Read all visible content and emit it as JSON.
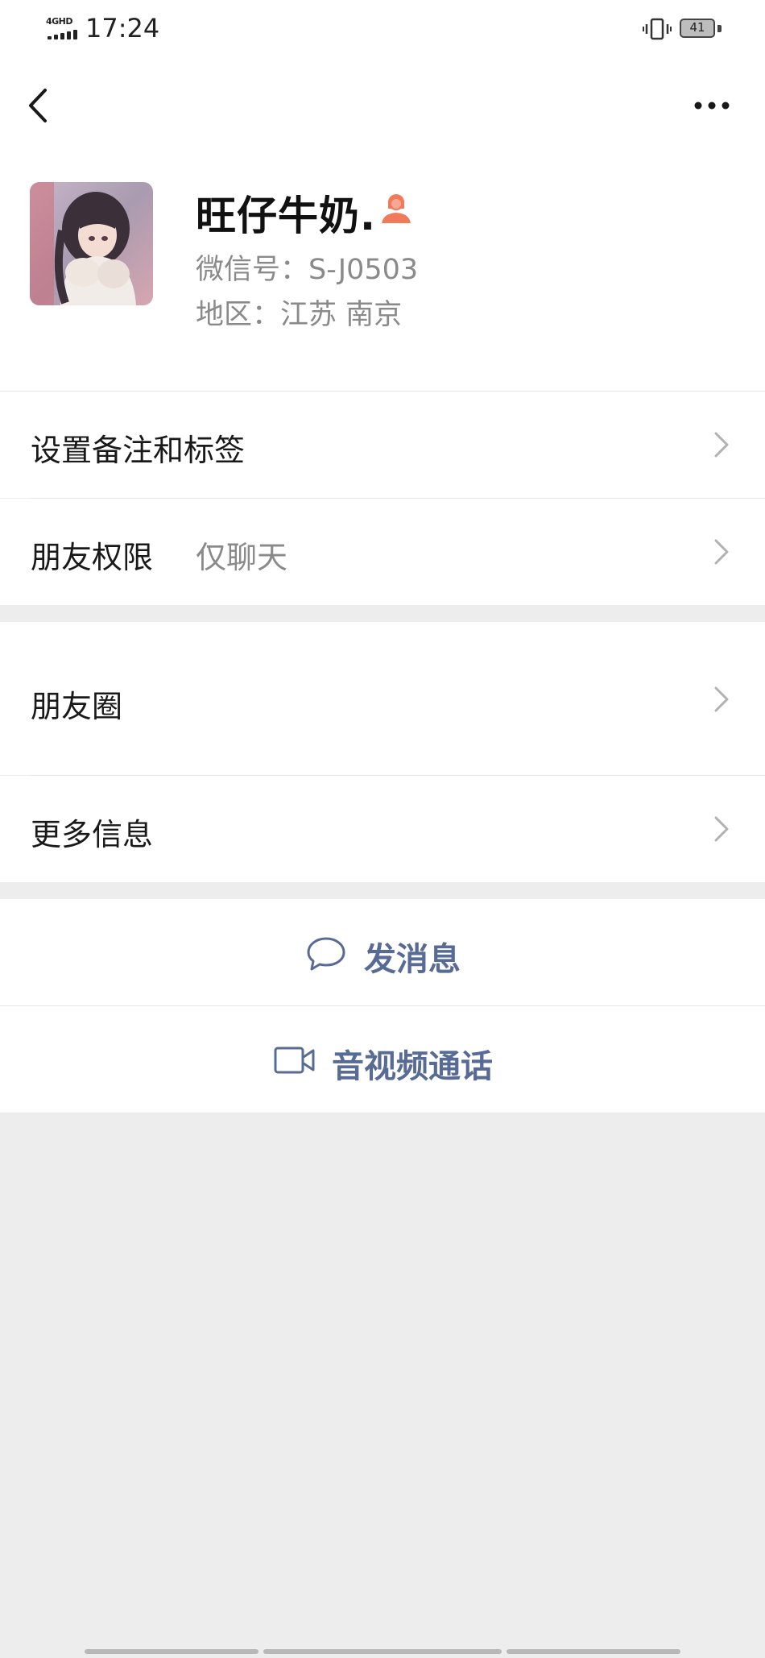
{
  "status_bar": {
    "network": "4GHD",
    "time": "17:24",
    "battery": "41"
  },
  "nav": {
    "back_icon": "back-chevron-icon",
    "more_icon": "more-dots-icon"
  },
  "profile": {
    "nickname": "旺仔牛奶.",
    "gender_icon": "female-icon",
    "gender_color": "#f07a5a",
    "wechat_id": "微信号：S-J0503",
    "region": "地区：江苏  南京"
  },
  "menu": {
    "remark_tags": "设置备注和标签",
    "friend_permission_label": "朋友权限",
    "friend_permission_value": "仅聊天",
    "moments": "朋友圈",
    "more_info": "更多信息"
  },
  "actions": {
    "send_message": "发消息",
    "video_call": "音视频通话",
    "accent_color": "#576b95"
  }
}
